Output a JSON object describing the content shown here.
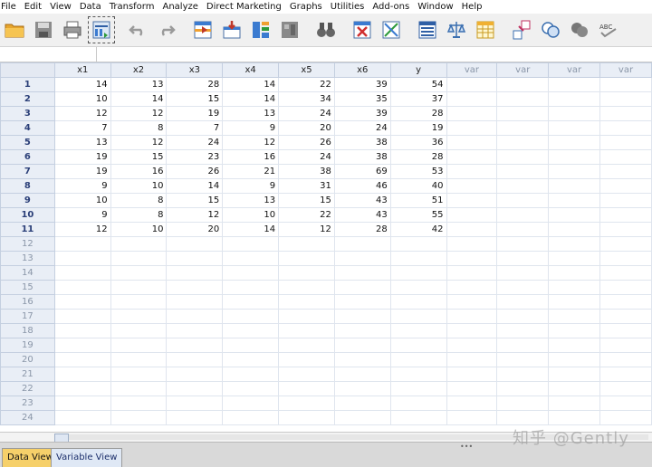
{
  "menu": [
    "File",
    "Edit",
    "View",
    "Data",
    "Transform",
    "Analyze",
    "Direct Marketing",
    "Graphs",
    "Utilities",
    "Add-ons",
    "Window",
    "Help"
  ],
  "toolbar_icons": [
    "open-folder-icon",
    "save-icon",
    "print-icon",
    "dialog-recall-icon",
    "undo-icon",
    "redo-icon",
    "goto-case-icon",
    "goto-variable-icon",
    "variables-icon",
    "binoculars-icon",
    "insert-cases-icon",
    "insert-variable-icon",
    "split-file-icon",
    "weight-cases-icon",
    "select-cases-icon",
    "value-labels-icon",
    "use-sets-icon",
    "show-all-variables-icon",
    "spell-check-icon"
  ],
  "grid": {
    "columns": [
      "x1",
      "x2",
      "x3",
      "x4",
      "x5",
      "x6",
      "y",
      "var",
      "var",
      "var",
      "var"
    ],
    "rows": [
      {
        "n": "1",
        "v": [
          "14",
          "13",
          "28",
          "14",
          "22",
          "39",
          "54"
        ]
      },
      {
        "n": "2",
        "v": [
          "10",
          "14",
          "15",
          "14",
          "34",
          "35",
          "37"
        ]
      },
      {
        "n": "3",
        "v": [
          "12",
          "12",
          "19",
          "13",
          "24",
          "39",
          "28"
        ]
      },
      {
        "n": "4",
        "v": [
          "7",
          "8",
          "7",
          "9",
          "20",
          "24",
          "19"
        ]
      },
      {
        "n": "5",
        "v": [
          "13",
          "12",
          "24",
          "12",
          "26",
          "38",
          "36"
        ]
      },
      {
        "n": "6",
        "v": [
          "19",
          "15",
          "23",
          "16",
          "24",
          "38",
          "28"
        ]
      },
      {
        "n": "7",
        "v": [
          "19",
          "16",
          "26",
          "21",
          "38",
          "69",
          "53"
        ]
      },
      {
        "n": "8",
        "v": [
          "9",
          "10",
          "14",
          "9",
          "31",
          "46",
          "40"
        ]
      },
      {
        "n": "9",
        "v": [
          "10",
          "8",
          "15",
          "13",
          "15",
          "43",
          "51"
        ]
      },
      {
        "n": "10",
        "v": [
          "9",
          "8",
          "12",
          "10",
          "22",
          "43",
          "55"
        ]
      },
      {
        "n": "11",
        "v": [
          "12",
          "10",
          "20",
          "14",
          "12",
          "28",
          "42"
        ]
      },
      {
        "n": "12",
        "v": []
      },
      {
        "n": "13",
        "v": []
      },
      {
        "n": "14",
        "v": []
      },
      {
        "n": "15",
        "v": []
      },
      {
        "n": "16",
        "v": []
      },
      {
        "n": "17",
        "v": []
      },
      {
        "n": "18",
        "v": []
      },
      {
        "n": "19",
        "v": []
      },
      {
        "n": "20",
        "v": []
      },
      {
        "n": "21",
        "v": []
      },
      {
        "n": "22",
        "v": []
      },
      {
        "n": "23",
        "v": []
      },
      {
        "n": "24",
        "v": []
      }
    ]
  },
  "tabs": {
    "data_view": "Data View",
    "variable_view": "Variable View"
  },
  "watermark": "知乎 @Gently"
}
